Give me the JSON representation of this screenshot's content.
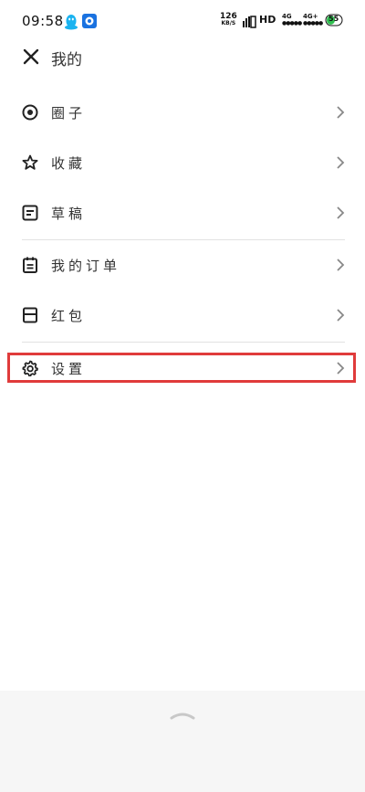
{
  "status": {
    "time": "09:58",
    "speed_value": "126",
    "speed_unit": "KB/S",
    "hd_label": "HD",
    "sim1_label": "4G",
    "sim2_label": "4G+",
    "battery": "55"
  },
  "header": {
    "title": "我的"
  },
  "menu": [
    {
      "label": "圈子",
      "icon": "circle-icon"
    },
    {
      "label": "收藏",
      "icon": "star-icon"
    },
    {
      "label": "草稿",
      "icon": "draft-icon"
    },
    {
      "label": "我的订单",
      "icon": "order-icon"
    },
    {
      "label": "红包",
      "icon": "envelope-icon"
    },
    {
      "label": "设置",
      "icon": "gear-icon"
    }
  ],
  "colors": {
    "highlight": "#e03b3b",
    "accent_qq": "#1ab3f0"
  }
}
